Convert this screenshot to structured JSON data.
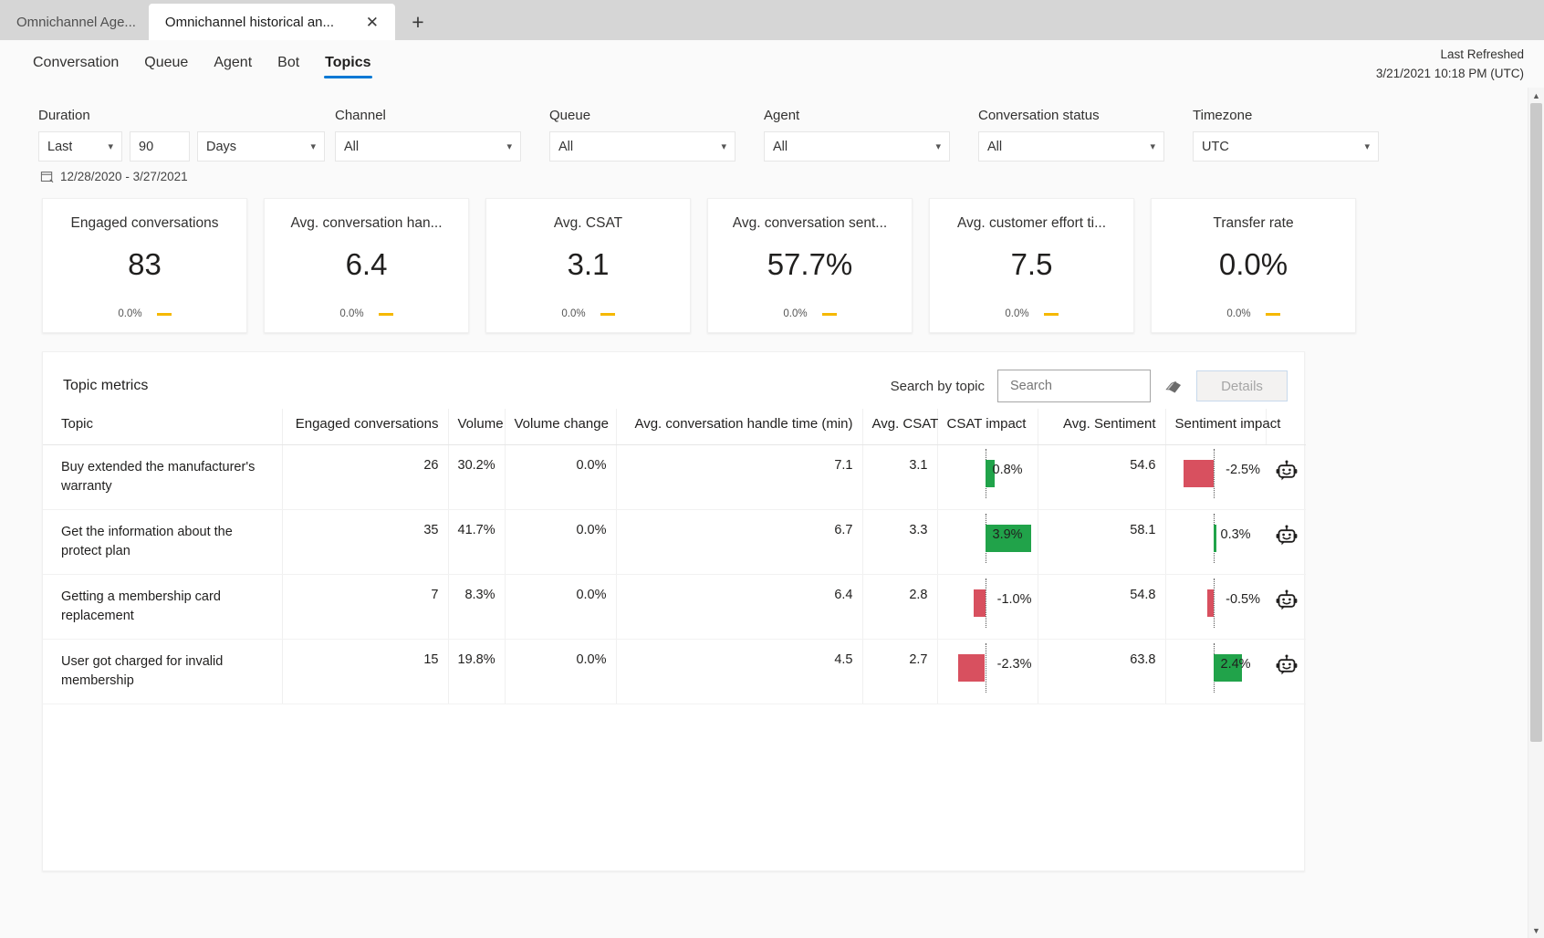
{
  "browser": {
    "tabs": [
      {
        "label": "Omnichannel Age...",
        "active": false
      },
      {
        "label": "Omnichannel historical an...",
        "active": true
      }
    ],
    "close_icon": "close-icon",
    "new_tab_icon": "plus-icon"
  },
  "nav": {
    "tabs": [
      {
        "label": "Conversation",
        "selected": false
      },
      {
        "label": "Queue",
        "selected": false
      },
      {
        "label": "Agent",
        "selected": false
      },
      {
        "label": "Bot",
        "selected": false
      },
      {
        "label": "Topics",
        "selected": true
      }
    ],
    "refresh_label": "Last Refreshed",
    "refresh_value": "3/21/2021 10:18 PM (UTC)"
  },
  "filters": {
    "duration": {
      "label": "Duration",
      "mode": "Last",
      "amount": "90",
      "unit": "Days"
    },
    "channel": {
      "label": "Channel",
      "value": "All"
    },
    "queue": {
      "label": "Queue",
      "value": "All"
    },
    "agent": {
      "label": "Agent",
      "value": "All"
    },
    "conversation_status": {
      "label": "Conversation status",
      "value": "All"
    },
    "timezone": {
      "label": "Timezone",
      "value": "UTC"
    },
    "date_range": "12/28/2020 - 3/27/2021"
  },
  "kpis": [
    {
      "title": "Engaged conversations",
      "value": "83",
      "delta": "0.0%"
    },
    {
      "title": "Avg. conversation han...",
      "value": "6.4",
      "delta": "0.0%"
    },
    {
      "title": "Avg. CSAT",
      "value": "3.1",
      "delta": "0.0%"
    },
    {
      "title": "Avg. conversation sent...",
      "value": "57.7%",
      "delta": "0.0%"
    },
    {
      "title": "Avg. customer effort ti...",
      "value": "7.5",
      "delta": "0.0%"
    },
    {
      "title": "Transfer rate",
      "value": "0.0%",
      "delta": "0.0%"
    }
  ],
  "panel": {
    "title": "Topic metrics",
    "search_label": "Search by topic",
    "search_placeholder": "Search",
    "search_value": "",
    "search_icon": "search-icon",
    "eraser_icon": "eraser-icon",
    "details_label": "Details"
  },
  "table": {
    "columns": [
      "Topic",
      "Engaged conversations",
      "Volume",
      "Volume change",
      "Avg. conversation handle time (min)",
      "Avg. CSAT",
      "CSAT impact",
      "Avg. Sentiment",
      "Sentiment impact"
    ],
    "rows": [
      {
        "topic": "Buy extended the manufacturer's warranty",
        "engaged_conversations": "26",
        "volume": "30.2%",
        "volume_change": "0.0%",
        "avg_handle_time": "7.1",
        "avg_csat": "3.1",
        "csat_impact": "0.8%",
        "csat_impact_num": 0.8,
        "avg_sentiment": "54.6",
        "sentiment_impact": "-2.5%",
        "sentiment_impact_num": -2.5,
        "bot_icon": "bot-icon"
      },
      {
        "topic": "Get the information about the protect plan",
        "engaged_conversations": "35",
        "volume": "41.7%",
        "volume_change": "0.0%",
        "avg_handle_time": "6.7",
        "avg_csat": "3.3",
        "csat_impact": "3.9%",
        "csat_impact_num": 3.9,
        "avg_sentiment": "58.1",
        "sentiment_impact": "0.3%",
        "sentiment_impact_num": 0.3,
        "bot_icon": "bot-icon"
      },
      {
        "topic": "Getting a membership card replacement",
        "engaged_conversations": "7",
        "volume": "8.3%",
        "volume_change": "0.0%",
        "avg_handle_time": "6.4",
        "avg_csat": "2.8",
        "csat_impact": "-1.0%",
        "csat_impact_num": -1.0,
        "avg_sentiment": "54.8",
        "sentiment_impact": "-0.5%",
        "sentiment_impact_num": -0.5,
        "bot_icon": "bot-icon"
      },
      {
        "topic": "User got charged for invalid membership",
        "engaged_conversations": "15",
        "volume": "19.8%",
        "volume_change": "0.0%",
        "avg_handle_time": "4.5",
        "avg_csat": "2.7",
        "csat_impact": "-2.3%",
        "csat_impact_num": -2.3,
        "avg_sentiment": "63.8",
        "sentiment_impact": "2.4%",
        "sentiment_impact_num": 2.4,
        "bot_icon": "bot-icon"
      }
    ]
  },
  "colors": {
    "accent": "#0078d4",
    "positive": "#21a34a",
    "negative": "#d8505f",
    "neutral_dash": "#f5b800"
  }
}
